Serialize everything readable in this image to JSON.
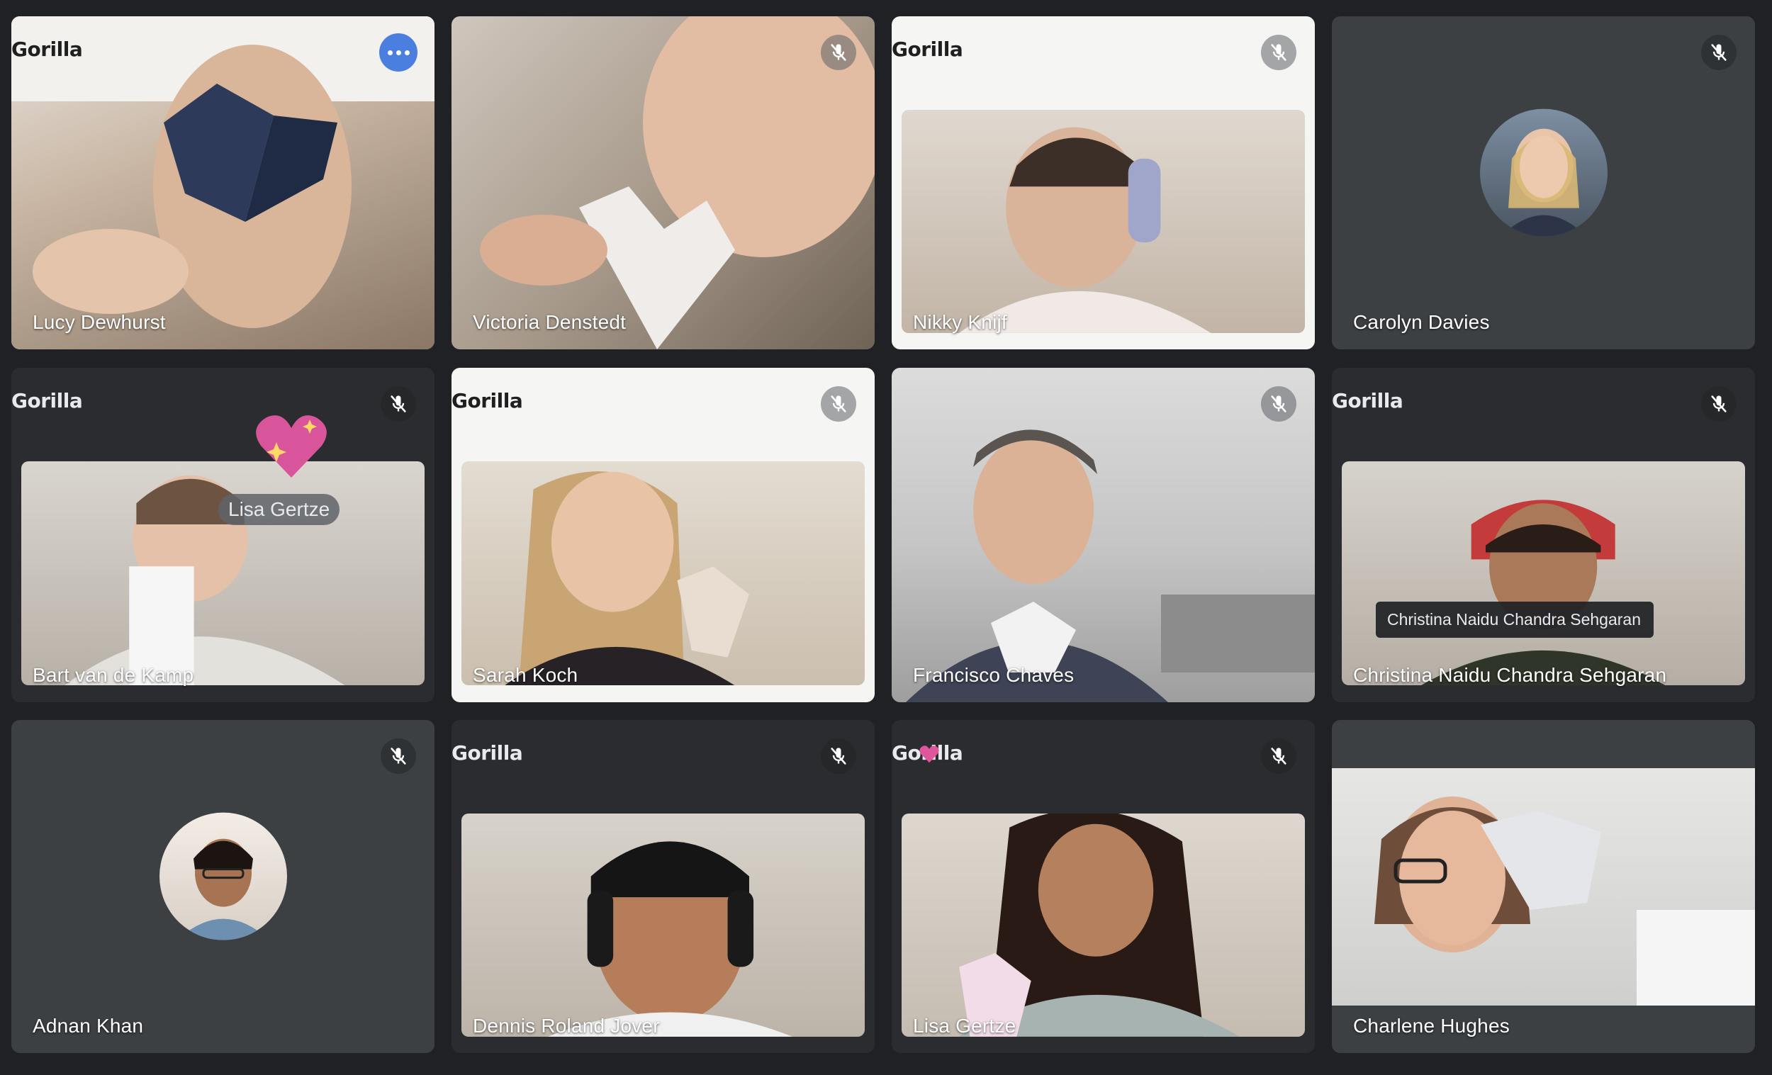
{
  "brand_label": "Gorilla",
  "colors": {
    "background": "#202124",
    "active_outline": "#8ab4f8",
    "more_button": "#4a7fe0"
  },
  "participants": [
    {
      "name": "Lucy Dewhurst",
      "muted": false,
      "speaking": true,
      "has_more_menu": true,
      "has_brand": true
    },
    {
      "name": "Victoria Denstedt",
      "muted": true,
      "has_brand": false
    },
    {
      "name": "Nikky Knijf",
      "muted": true,
      "has_brand": true
    },
    {
      "name": "Carolyn Davies",
      "muted": true,
      "camera_off": true,
      "has_brand": false
    },
    {
      "name": "Bart van de Kamp",
      "muted": true,
      "has_brand": true,
      "overlay_chip": "Lisa Gertze"
    },
    {
      "name": "Sarah Koch",
      "muted": true,
      "has_brand": true
    },
    {
      "name": "Francisco Chaves",
      "muted": true,
      "has_brand": false
    },
    {
      "name": "Christina Naidu Chandra Sehgaran",
      "muted": true,
      "has_brand": true,
      "tooltip": "Christina Naidu Chandra Sehgaran"
    },
    {
      "name": "Adnan Khan",
      "muted": true,
      "camera_off": true,
      "has_brand": false
    },
    {
      "name": "Dennis Roland Jover",
      "muted": true,
      "has_brand": true
    },
    {
      "name": "Lisa Gertze",
      "muted": true,
      "has_brand": true
    },
    {
      "name": "Charlene Hughes",
      "muted": false,
      "has_brand": false
    }
  ],
  "icons": {
    "mic_off": "mic-off-icon",
    "more": "more-options-icon",
    "reaction": "sparkling-heart-icon"
  }
}
